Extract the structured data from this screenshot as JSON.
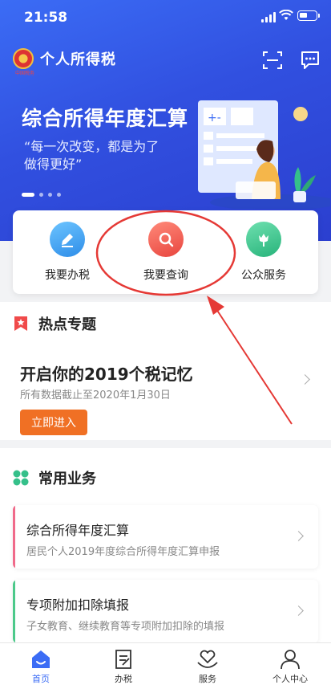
{
  "status_bar": {
    "time": "21:58"
  },
  "header": {
    "app_title": "个人所得税",
    "emblem_caption": "中国税务"
  },
  "banner": {
    "title": "综合所得年度汇算",
    "subtitle": "“每一次改变，都是为了做得更好”"
  },
  "quick_actions": [
    {
      "label": "我要办税",
      "icon": "edit-icon",
      "color": "#3aa0f0"
    },
    {
      "label": "我要查询",
      "icon": "search-icon",
      "color": "#f0504a"
    },
    {
      "label": "公众服务",
      "icon": "flower-icon",
      "color": "#35c08a"
    }
  ],
  "hot_topics": {
    "section_title": "热点专题",
    "item_title": "开启你的2019个税记忆",
    "item_subtitle": "所有数据截止至2020年1月30日",
    "enter_label": "立即进入"
  },
  "common_business": {
    "section_title": "常用业务",
    "items": [
      {
        "title": "综合所得年度汇算",
        "subtitle": "居民个人2019年度综合所得年度汇算申报",
        "accent": "#f06a8a"
      },
      {
        "title": "专项附加扣除填报",
        "subtitle": "子女教育、继续教育等专项附加扣除的填报",
        "accent": "#4cc98a"
      }
    ]
  },
  "tabbar": {
    "items": [
      {
        "label": "首页",
        "icon": "home-icon"
      },
      {
        "label": "办税",
        "icon": "document-icon"
      },
      {
        "label": "服务",
        "icon": "heart-hand-icon"
      },
      {
        "label": "个人中心",
        "icon": "person-icon"
      }
    ],
    "active": "首页"
  },
  "colors": {
    "primary": "#3b6cf5",
    "accent_orange": "#f07024",
    "annotation_red": "#e53935"
  }
}
